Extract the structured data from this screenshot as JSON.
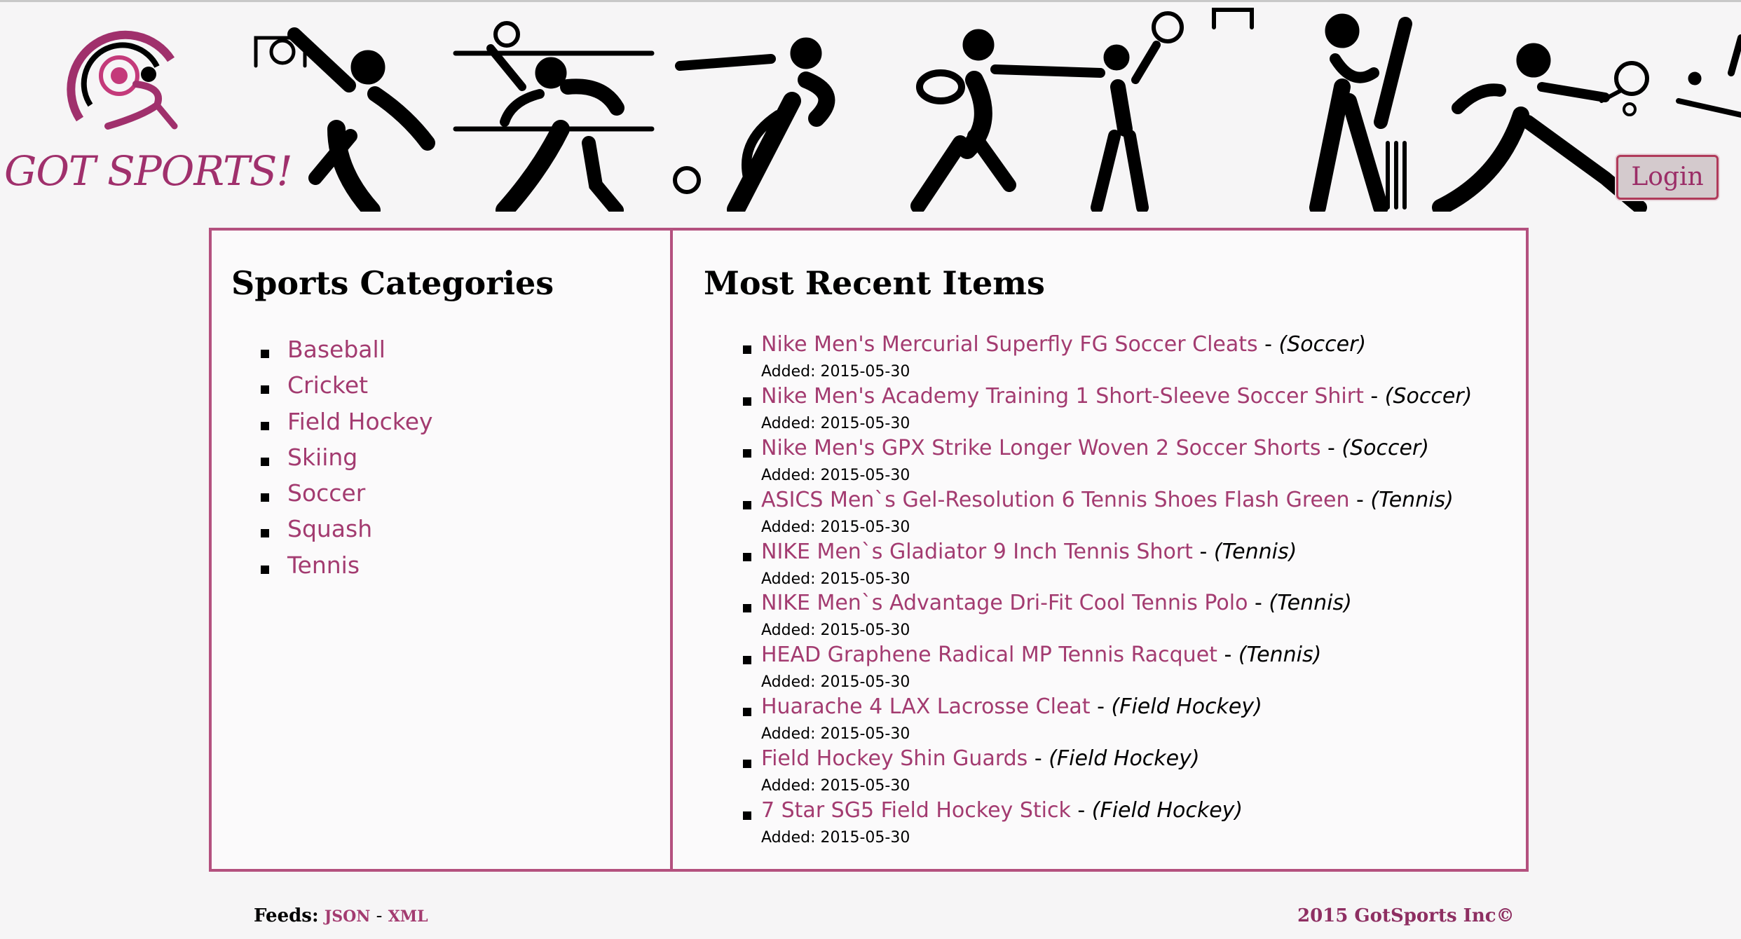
{
  "header": {
    "logo_text": "GOT SPORTS!",
    "login_label": "Login"
  },
  "categories": {
    "title": "Sports Categories",
    "items": [
      "Baseball",
      "Cricket",
      "Field Hockey",
      "Skiing",
      "Soccer",
      "Squash",
      "Tennis"
    ]
  },
  "recent": {
    "title": "Most Recent Items",
    "items": [
      {
        "name": "Nike Men's Mercurial Superfly FG Soccer Cleats",
        "category": "(Soccer)",
        "added": "Added: 2015-05-30"
      },
      {
        "name": "Nike Men's Academy Training 1 Short-Sleeve Soccer Shirt",
        "category": "(Soccer)",
        "added": "Added: 2015-05-30"
      },
      {
        "name": "Nike Men's GPX Strike Longer Woven 2 Soccer Shorts",
        "category": "(Soccer)",
        "added": "Added: 2015-05-30"
      },
      {
        "name": "ASICS Men`s Gel-Resolution 6 Tennis Shoes Flash Green",
        "category": "(Tennis)",
        "added": "Added: 2015-05-30"
      },
      {
        "name": "NIKE Men`s Gladiator 9 Inch Tennis Short",
        "category": "(Tennis)",
        "added": "Added: 2015-05-30"
      },
      {
        "name": "NIKE Men`s Advantage Dri-Fit Cool Tennis Polo",
        "category": "(Tennis)",
        "added": "Added: 2015-05-30"
      },
      {
        "name": "HEAD Graphene Radical MP Tennis Racquet",
        "category": "(Tennis)",
        "added": "Added: 2015-05-30"
      },
      {
        "name": "Huarache 4 LAX Lacrosse Cleat",
        "category": "(Field Hockey)",
        "added": "Added: 2015-05-30"
      },
      {
        "name": "Field Hockey Shin Guards",
        "category": "(Field Hockey)",
        "added": "Added: 2015-05-30"
      },
      {
        "name": "7 Star SG5 Field Hockey Stick",
        "category": "(Field Hockey)",
        "added": "Added: 2015-05-30"
      }
    ]
  },
  "footer": {
    "feeds_label": "Feeds:",
    "json_label": "JSON",
    "separator": "-",
    "xml_label": "XML",
    "copyright": "2015 GotSports Inc©"
  },
  "colors": {
    "accent": "#a33b70",
    "panel_border": "#b4517f",
    "background": "#f6f5f6"
  }
}
